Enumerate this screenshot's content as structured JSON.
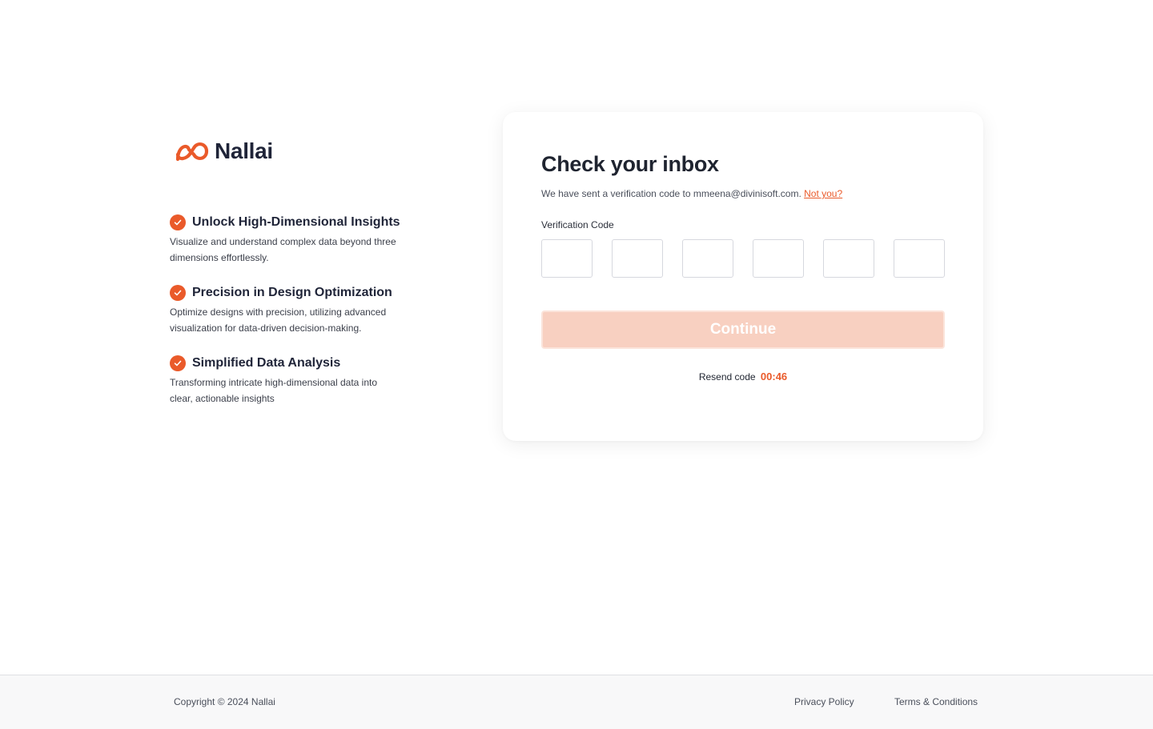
{
  "brand": {
    "name": "Nallai",
    "logo_icon": "nallai-infinity-logo",
    "accent_color": "#ea5a2a"
  },
  "features": [
    {
      "title": "Unlock High-Dimensional Insights",
      "description": "Visualize and understand complex data beyond three dimensions effortlessly."
    },
    {
      "title": "Precision in Design Optimization",
      "description": "Optimize designs with precision, utilizing advanced visualization for data-driven decision-making."
    },
    {
      "title": "Simplified Data Analysis",
      "description": "Transforming intricate high-dimensional data into clear, actionable insights"
    }
  ],
  "card": {
    "title": "Check your inbox",
    "subtitle": "We have sent a verification code to mmeena@divinisoft.com.",
    "not_you": "Not you?",
    "code_label": "Verification Code",
    "code_digits": [
      "",
      "",
      "",
      "",
      "",
      ""
    ],
    "continue_label": "Continue",
    "resend_label": "Resend code",
    "resend_timer": "00:46"
  },
  "footer": {
    "copyright": "Copyright © 2024 Nallai",
    "privacy": "Privacy Policy",
    "terms": "Terms & Conditions"
  }
}
